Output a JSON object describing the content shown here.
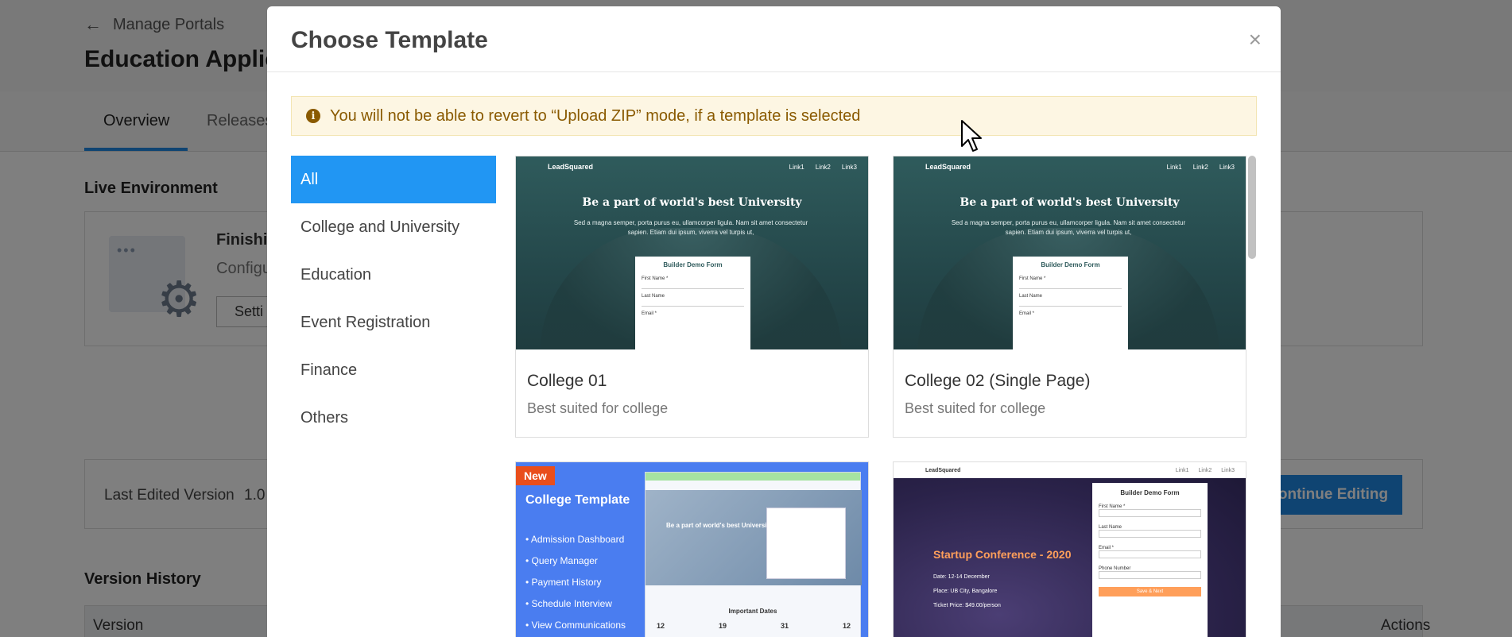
{
  "background": {
    "back_link": "Manage Portals",
    "page_title": "Education Applic",
    "tabs": [
      "Overview",
      "Releases"
    ],
    "live_env_heading": "Live Environment",
    "env_title": "Finishin",
    "env_subtitle": "Configu",
    "env_button": "Setti",
    "last_edited_label": "Last Edited Version",
    "last_edited_value": "1.0",
    "continue_button": "ontinue Editing",
    "version_history_heading": "Version History",
    "table_columns": [
      "Version",
      "Actions"
    ]
  },
  "modal": {
    "title": "Choose Template",
    "close_glyph": "×",
    "alert_icon": "i",
    "alert_text": "You will not be able to revert to “Upload ZIP” mode, if a template is selected",
    "categories": [
      {
        "label": "All",
        "active": true
      },
      {
        "label": "College and University"
      },
      {
        "label": "Education"
      },
      {
        "label": "Event Registration"
      },
      {
        "label": "Finance"
      },
      {
        "label": "Others"
      }
    ],
    "templates": [
      {
        "name": "College 01",
        "description": "Best suited for college"
      },
      {
        "name": "College 02 (Single Page)",
        "description": "Best suited for college"
      }
    ],
    "college_thumb": {
      "logo": "LeadSquared",
      "links": [
        "Link1",
        "Link2",
        "Link3"
      ],
      "headline": "Be a part of world's best University",
      "subtext": "Sed a magna semper, porta purus eu, ullamcorper ligula. Nam sit amet consectetur sapien. Etiam dui ipsum, viverra vel turpis ut,",
      "form_title": "Builder Demo Form",
      "fields": [
        "First Name *",
        "Last Name",
        "Email *"
      ]
    },
    "new_thumb": {
      "badge": "New",
      "title": "College Template",
      "features": [
        "• Admission Dashboard",
        "• Query Manager",
        "• Payment History",
        "• Schedule Interview",
        "• View Communications"
      ],
      "hero_title": "Be a part of world's best University",
      "section": "Important Dates",
      "dates": [
        "12",
        "19",
        "31",
        "12"
      ]
    },
    "conf_thumb": {
      "logo": "LeadSquared",
      "links": [
        "Link1",
        "Link2",
        "Link3"
      ],
      "title": "Startup Conference - 2020",
      "details": [
        "Date: 12-14 December",
        "Place: UB City, Bangalore",
        "Ticket Price: $49.00/person"
      ],
      "form_title": "Builder Demo Form",
      "fields": [
        "First Name *",
        "Last Name",
        "Email *",
        "Phone Number"
      ],
      "submit": "Save & Next"
    }
  }
}
